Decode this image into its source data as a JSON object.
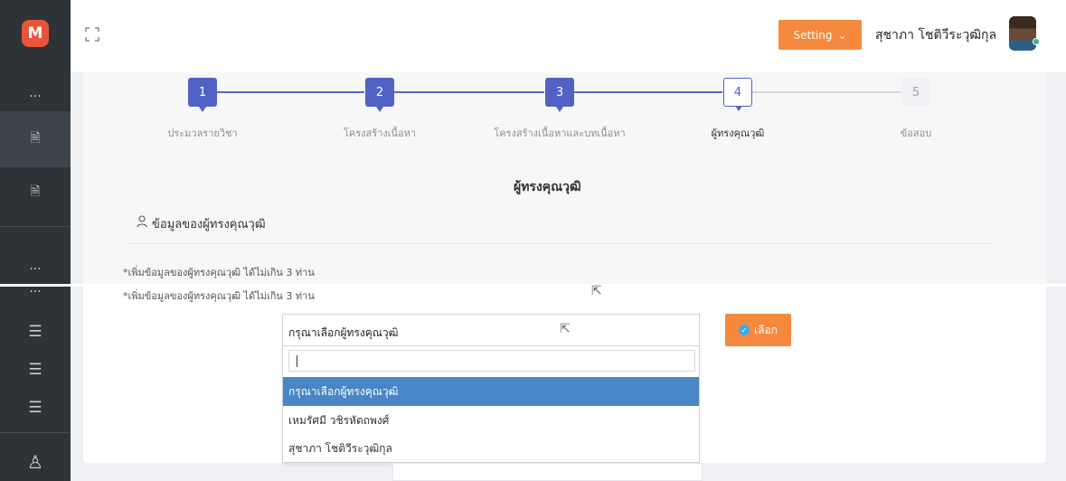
{
  "app": {
    "logo_letter": "M"
  },
  "sidebar": {
    "items": [
      {
        "name": "more-dots-1",
        "label": "···"
      },
      {
        "name": "document-1",
        "label": "🗎"
      },
      {
        "name": "document-2",
        "label": "🗎"
      },
      {
        "name": "more-dots-2",
        "label": "···"
      },
      {
        "name": "more-dots-3",
        "label": "···"
      },
      {
        "name": "menu-1",
        "label": "☰"
      },
      {
        "name": "menu-2",
        "label": "☰"
      },
      {
        "name": "menu-3",
        "label": "☰"
      },
      {
        "name": "user",
        "label": "♙"
      }
    ]
  },
  "header": {
    "setting_label": "Setting",
    "setting_chevron": "⌄",
    "user_name": "สุชาภา โชติวีระวุฒิกุล"
  },
  "stepper": {
    "steps": [
      {
        "number": "1",
        "label": "ประมวลรายวิชา",
        "state": "done"
      },
      {
        "number": "2",
        "label": "โครงสร้างเนื้อหา",
        "state": "done"
      },
      {
        "number": "3",
        "label": "โครงสร้างเนื้อหาและบทเนื้อหา",
        "state": "done"
      },
      {
        "number": "4",
        "label": "ผู้ทรงคุณวุฒิ",
        "state": "current"
      },
      {
        "number": "5",
        "label": "ข้อสอบ",
        "state": "future"
      }
    ]
  },
  "main": {
    "section_title": "ผู้ทรงคุณวุฒิ",
    "info_heading": "ข้อมูลของผู้ทรงคุณวุฒิ",
    "note_1": "*เพิ่มข้อมูลของผู้ทรงคุณวุฒิ ได้ไม่เกิน 3 ท่าน",
    "note_2": "*เพิ่มข้อมูลของผู้ทรงคุณวุฒิ ได้ไม่เกิน 3 ท่าน",
    "select_value": "กรุณาเลือกผู้ทรงคุณวุฒิ",
    "choose_button": "เลือก",
    "dropdown_options": [
      "กรุณาเลือกผู้ทรงคุณวุฒิ",
      "เหมรัศมี วชิรหัตถพงศ์",
      "สุชาภา โชติวีระวุฒิกุล"
    ],
    "selected_option_index": 0
  },
  "colors": {
    "sidebar_bg": "#2e3338",
    "accent_orange": "#f5883d",
    "step_blue": "#5262c4",
    "option_highlight": "#4a86c5",
    "logo_red": "#e8553a"
  }
}
